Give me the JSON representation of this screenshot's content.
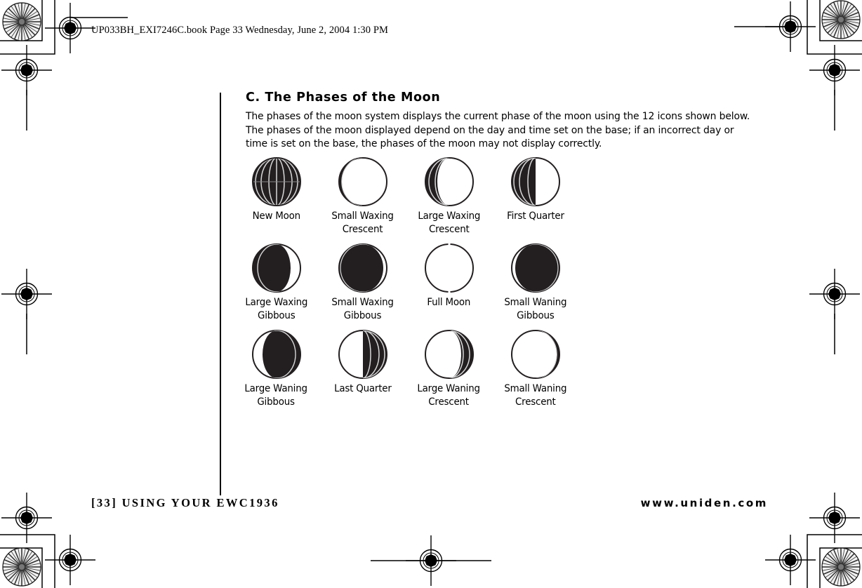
{
  "page": {
    "header_line": "UP033BH_EXI7246C.book  Page 33  Wednesday, June 2, 2004  1:30 PM",
    "background_color": "#ffffff",
    "ink_color": "#1a1a1a"
  },
  "content": {
    "section_title": "C. The Phases of the Moon",
    "paragraph": "The phases of the moon system displays the current phase of the moon using the 12 icons shown below. The phases of the moon displayed depend on the day and time set on the base; if an incorrect day or time is set on the base, the phases of the moon may not display correctly."
  },
  "moon_phases": {
    "count": 12,
    "rows": [
      [
        {
          "label": "New Moon",
          "icon": "moon-new-icon",
          "lit_fraction": 0.0,
          "shape": "full-dark"
        },
        {
          "label": "Small Waxing\nCrescent",
          "icon": "moon-small-waxing-crescent-icon",
          "lit_fraction": 0.08,
          "shape": "dark-with-right-sliver"
        },
        {
          "label": "Large Waxing\nCrescent",
          "icon": "moon-large-waxing-crescent-icon",
          "lit_fraction": 0.25,
          "shape": "dark-with-right-crescent"
        },
        {
          "label": "First Quarter",
          "icon": "moon-first-quarter-icon",
          "lit_fraction": 0.5,
          "shape": "left-dark-half"
        }
      ],
      [
        {
          "label": "Large Waxing\nGibbous",
          "icon": "moon-large-waxing-gibbous-icon",
          "lit_fraction": 0.72,
          "shape": "left-dark-crescent"
        },
        {
          "label": "Small Waxing\nGibbous",
          "icon": "moon-small-waxing-gibbous-icon",
          "lit_fraction": 0.88,
          "shape": "left-dark-sliver"
        },
        {
          "label": "Full Moon",
          "icon": "moon-full-icon",
          "lit_fraction": 1.0,
          "shape": "empty-circle"
        },
        {
          "label": "Small Waning\nGibbous",
          "icon": "moon-small-waning-gibbous-icon",
          "lit_fraction": 0.88,
          "shape": "right-dark-sliver"
        }
      ],
      [
        {
          "label": "Large Waning\nGibbous",
          "icon": "moon-large-waning-gibbous-icon",
          "lit_fraction": 0.72,
          "shape": "right-dark-crescent"
        },
        {
          "label": "Last Quarter",
          "icon": "moon-last-quarter-icon",
          "lit_fraction": 0.5,
          "shape": "right-dark-half"
        },
        {
          "label": "Large Waning\nCrescent",
          "icon": "moon-large-waning-crescent-icon",
          "lit_fraction": 0.25,
          "shape": "dark-with-left-crescent"
        },
        {
          "label": "Small Waning\nCrescent",
          "icon": "moon-small-waning-crescent-icon",
          "lit_fraction": 0.08,
          "shape": "dark-with-left-sliver"
        }
      ]
    ]
  },
  "footer": {
    "left": "[33] USING YOUR EWC1936",
    "right": "www.uniden.com"
  },
  "prepress_marks": {
    "registration_targets": 7,
    "starburst_targets": 4,
    "corner_crop_marks": 4,
    "description": "registration-bullseye and radial-starburst calibration targets"
  }
}
